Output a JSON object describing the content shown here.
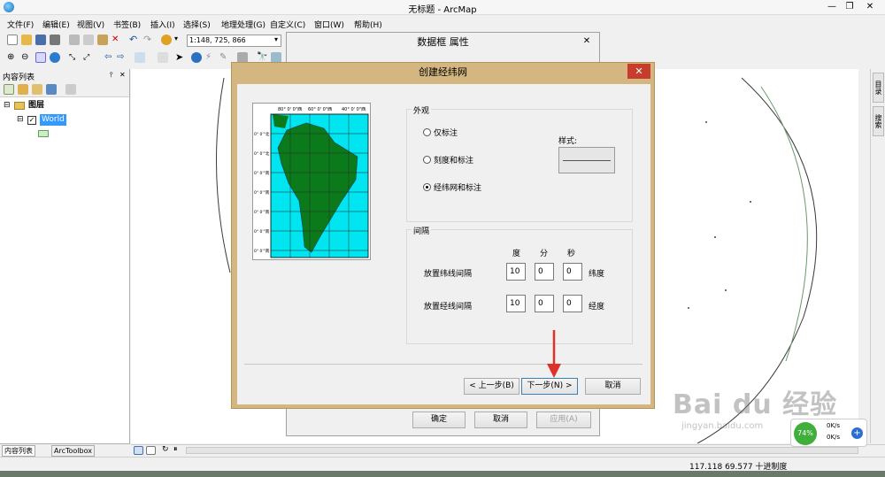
{
  "window": {
    "title": "无标题 - ArcMap"
  },
  "menu": [
    "文件(F)",
    "编辑(E)",
    "视图(V)",
    "书签(B)",
    "插入(I)",
    "选择(S)",
    "地理处理(G)",
    "自定义(C)",
    "窗口(W)",
    "帮助(H)"
  ],
  "toolbar": {
    "scale": "1:148, 725, 866"
  },
  "toc": {
    "title": "内容列表",
    "root_label": "图层",
    "layer_label": "World",
    "tabs": [
      "内容列表",
      "ArcToolbox"
    ]
  },
  "right_rail": [
    "目录",
    "搜索"
  ],
  "bg_dialog": {
    "title": "数据框 属性",
    "ok": "确定",
    "cancel": "取消",
    "apply": "应用(A)"
  },
  "dialog": {
    "title": "创建经纬网",
    "preview_labels": {
      "top": [
        "80° 0' 0\"西",
        "60° 0' 0\"西",
        "40° 0' 0\"西"
      ],
      "left": [
        "0° 0'\"北",
        "0° 0'\"北",
        "0° 0'\"南",
        "0° 0'\"南",
        "0° 0'\"南",
        "0° 0'\"南",
        "0° 0'\"南"
      ]
    },
    "appearance": {
      "title": "外观",
      "options": [
        "仅标注",
        "刻度和标注",
        "经纬网和标注"
      ],
      "selected": 2,
      "style_label": "样式:"
    },
    "interval": {
      "title": "间隔",
      "headers": [
        "度",
        "分",
        "秒"
      ],
      "rows": [
        {
          "label": "放置纬线间隔",
          "deg": "10",
          "min": "0",
          "sec": "0",
          "unit": "纬度"
        },
        {
          "label": "放置经线间隔",
          "deg": "10",
          "min": "0",
          "sec": "0",
          "unit": "经度"
        }
      ]
    },
    "buttons": {
      "back": "< 上一步(B)",
      "next": "下一步(N) >",
      "cancel": "取消"
    }
  },
  "status": {
    "coords": "117.118   69.577 十进制度"
  },
  "watermark": {
    "brand": "Bai du 经验",
    "url": "jingyan.baidu.com"
  },
  "net_widget": {
    "percent": "74%",
    "up": "0K/s",
    "down": "0K/s"
  },
  "colors": {
    "dialog_frame": "#d4b680",
    "close_red": "#c73c2c",
    "arrow_red": "#e0302a",
    "ocean": "#00e5f0",
    "land": "#0b7a1a"
  }
}
